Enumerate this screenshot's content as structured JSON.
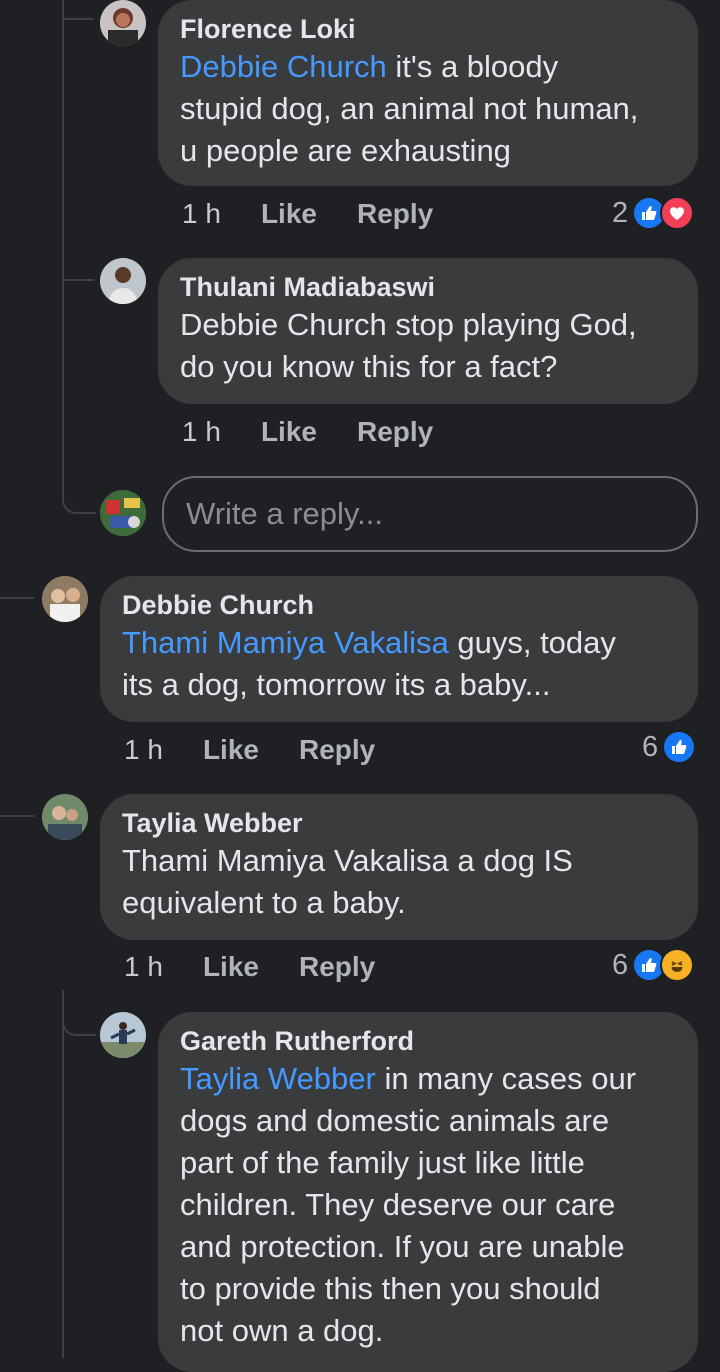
{
  "comments": [
    {
      "author": "Florence Loki",
      "mention": "Debbie Church",
      "text_lines": [
        " it's a bloody",
        "stupid dog, an animal not human,",
        "u people are exhausting"
      ],
      "time": "1 h",
      "like_label": "Like",
      "reply_label": "Reply",
      "reaction_count": "2",
      "reactions": [
        "like-icon",
        "love-icon"
      ]
    },
    {
      "author": "Thulani Madiabaswi",
      "text_lines": [
        "Debbie Church stop playing God,",
        "do you know this for a fact?"
      ],
      "time": "1 h",
      "like_label": "Like",
      "reply_label": "Reply"
    },
    {
      "author": "Debbie Church",
      "mention": "Thami Mamiya Vakalisa",
      "text_lines": [
        " guys, today",
        "its a dog, tomorrow its a baby..."
      ],
      "time": "1 h",
      "like_label": "Like",
      "reply_label": "Reply",
      "reaction_count": "6",
      "reactions": [
        "like-icon"
      ]
    },
    {
      "author": "Taylia Webber",
      "text_lines": [
        "Thami Mamiya Vakalisa a dog IS",
        "equivalent to a baby."
      ],
      "time": "1 h",
      "like_label": "Like",
      "reply_label": "Reply",
      "reaction_count": "6",
      "reactions": [
        "like-icon",
        "haha-icon"
      ]
    },
    {
      "author": "Gareth Rutherford",
      "mention": "Taylia Webber",
      "text_lines": [
        " in many cases our",
        "dogs and domestic animals are",
        "part of the family just like little",
        "children. They deserve our care",
        "and protection.  If you are unable",
        "to provide this then you should",
        "not own a dog."
      ]
    }
  ],
  "reply_input": {
    "placeholder": "Write a reply..."
  },
  "colors": {
    "background": "#1f2023",
    "bubble": "#3a3b3c",
    "mention": "#4599ff",
    "like": "#1877f2",
    "love": "#f33e58",
    "haha": "#f7b125"
  }
}
